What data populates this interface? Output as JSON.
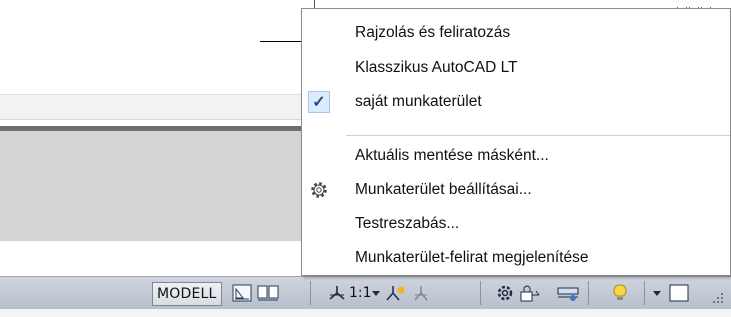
{
  "menu": {
    "items": [
      {
        "label": "Rajzolás és feliratozás",
        "checked": false
      },
      {
        "label": "Klasszikus AutoCAD LT",
        "checked": false
      },
      {
        "label": "saját munkaterület",
        "checked": true,
        "check_glyph": "✓"
      },
      {
        "label": "Aktuális mentése másként...",
        "checked": false
      },
      {
        "label": "Munkaterület beállításai...",
        "checked": false,
        "icon": "gear-icon"
      },
      {
        "label": "Testreszabás...",
        "checked": false
      },
      {
        "label": "Munkaterület-felirat megjelenítése",
        "checked": false
      }
    ]
  },
  "statusbar": {
    "model_label": "MODELL",
    "scale_label": "1:1",
    "icons": [
      "layout-icon",
      "quickview-layouts-icon",
      "annotation-scale-icon",
      "dropdown-arrow-icon",
      "annotation-visibility-icon",
      "autoscale-icon",
      "workspace-gear-icon",
      "lock-icon",
      "hardware-acceleration-icon",
      "isolate-objects-icon",
      "bulb-icon",
      "menu-arrow-icon",
      "clean-screen-icon",
      "resize-grip-icon"
    ]
  },
  "colors": {
    "check_bg": "#dcecfc",
    "statusbar_bg": "#c3cad5",
    "panel_bg": "#d4d4d4"
  }
}
